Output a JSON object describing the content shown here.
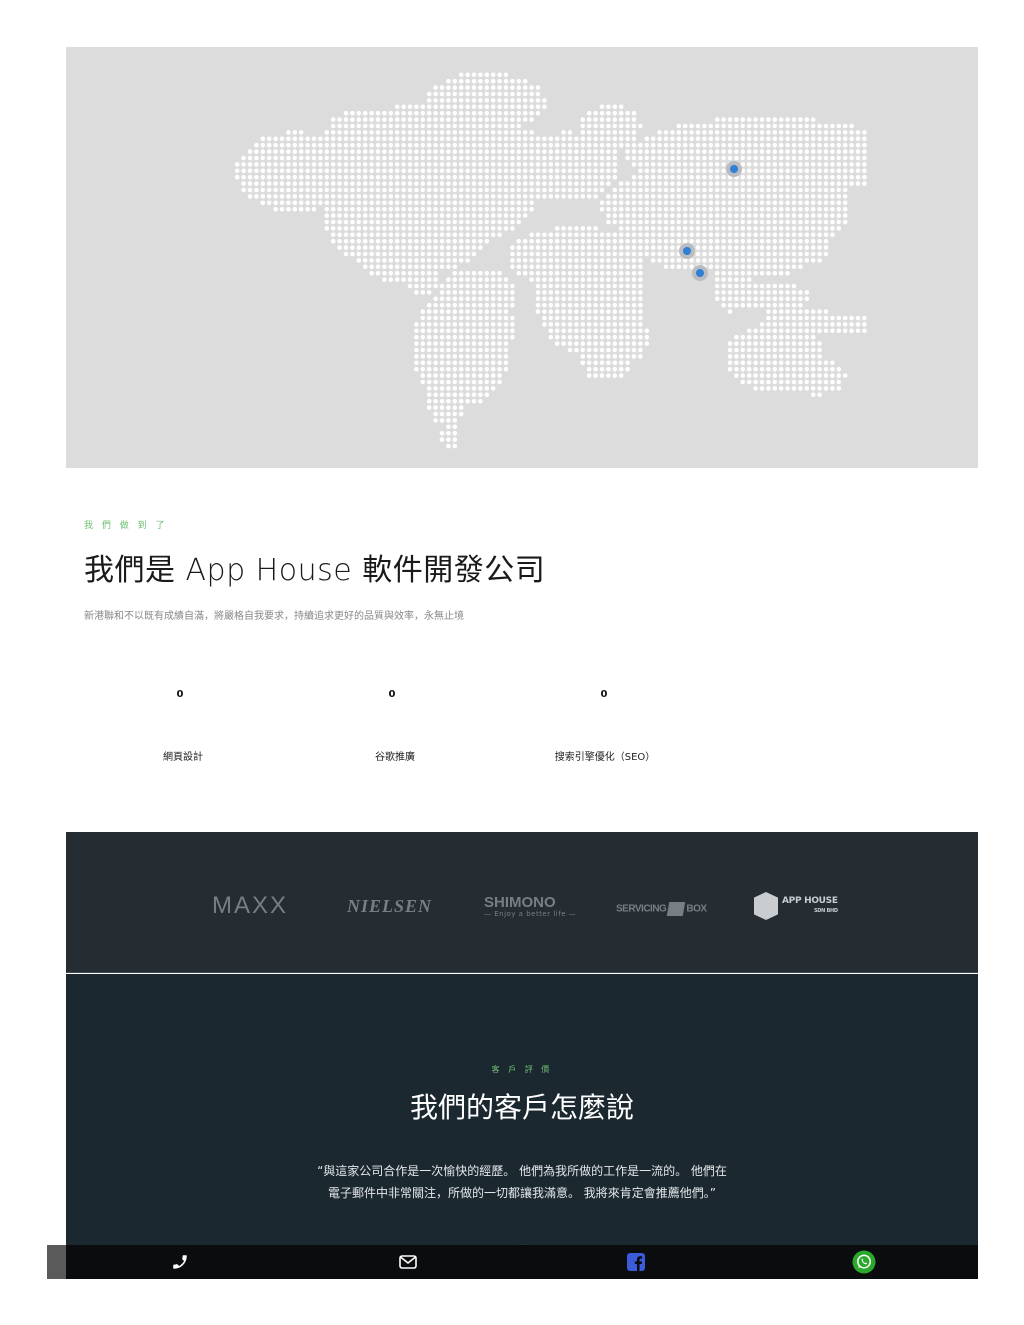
{
  "map": {
    "background": "#dcdcdc",
    "marker_color": "#2f7fd4"
  },
  "about": {
    "eyebrow": "我 們 做 到 了",
    "title": "我們是 App House 軟件開發公司",
    "description": "新港聯和不以既有成績自滿，將嚴格自我要求，持續追求更好的品質與效率，永無止境"
  },
  "stats": [
    {
      "value": "0",
      "label": "網頁設計"
    },
    {
      "value": "0",
      "label": "谷歌推廣"
    },
    {
      "value": "0",
      "label": "搜索引擎優化（SEO）"
    }
  ],
  "clients": {
    "logos": [
      {
        "name": "MAXX"
      },
      {
        "name": "NIELSEN"
      },
      {
        "name": "SHIMONO",
        "tagline": "— Enjoy a better life —"
      },
      {
        "name_left": "SERVICING",
        "name_right": "BOX"
      },
      {
        "name": "APP HOUSE",
        "sub": "SDN BHD"
      }
    ]
  },
  "testimonials": {
    "eyebrow": "客 戶 評 價",
    "title": "我們的客戶怎麼說",
    "quote": "“與這家公司合作是一次愉快的經歷。 他們為我所做的工作是一流的。 他們在電子郵件中非常關注，所做的一切都讓我滿意。 我將來肯定會推薦他們。”",
    "quote_mark": "❞"
  },
  "contact_bar": {
    "items": [
      {
        "icon": "phone-icon"
      },
      {
        "icon": "envelope-icon"
      },
      {
        "icon": "facebook-icon",
        "color": "#3b5bdb"
      },
      {
        "icon": "whatsapp-icon",
        "color": "#2ca82c"
      }
    ]
  }
}
